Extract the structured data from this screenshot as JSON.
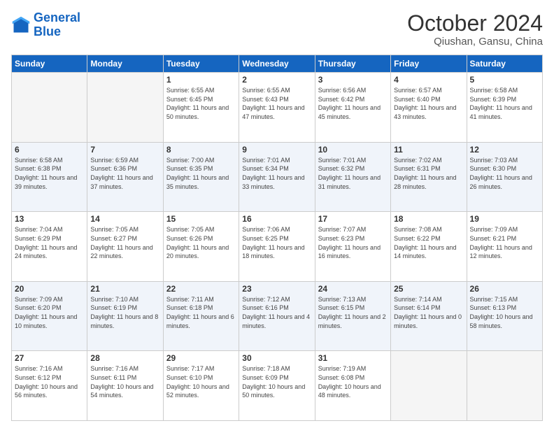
{
  "logo": {
    "line1": "General",
    "line2": "Blue"
  },
  "title": "October 2024",
  "subtitle": "Qiushan, Gansu, China",
  "days_of_week": [
    "Sunday",
    "Monday",
    "Tuesday",
    "Wednesday",
    "Thursday",
    "Friday",
    "Saturday"
  ],
  "weeks": [
    [
      {
        "day": "",
        "sunrise": "",
        "sunset": "",
        "daylight": "",
        "empty": true
      },
      {
        "day": "",
        "sunrise": "",
        "sunset": "",
        "daylight": "",
        "empty": true
      },
      {
        "day": "1",
        "sunrise": "Sunrise: 6:55 AM",
        "sunset": "Sunset: 6:45 PM",
        "daylight": "Daylight: 11 hours and 50 minutes."
      },
      {
        "day": "2",
        "sunrise": "Sunrise: 6:55 AM",
        "sunset": "Sunset: 6:43 PM",
        "daylight": "Daylight: 11 hours and 47 minutes."
      },
      {
        "day": "3",
        "sunrise": "Sunrise: 6:56 AM",
        "sunset": "Sunset: 6:42 PM",
        "daylight": "Daylight: 11 hours and 45 minutes."
      },
      {
        "day": "4",
        "sunrise": "Sunrise: 6:57 AM",
        "sunset": "Sunset: 6:40 PM",
        "daylight": "Daylight: 11 hours and 43 minutes."
      },
      {
        "day": "5",
        "sunrise": "Sunrise: 6:58 AM",
        "sunset": "Sunset: 6:39 PM",
        "daylight": "Daylight: 11 hours and 41 minutes."
      }
    ],
    [
      {
        "day": "6",
        "sunrise": "Sunrise: 6:58 AM",
        "sunset": "Sunset: 6:38 PM",
        "daylight": "Daylight: 11 hours and 39 minutes."
      },
      {
        "day": "7",
        "sunrise": "Sunrise: 6:59 AM",
        "sunset": "Sunset: 6:36 PM",
        "daylight": "Daylight: 11 hours and 37 minutes."
      },
      {
        "day": "8",
        "sunrise": "Sunrise: 7:00 AM",
        "sunset": "Sunset: 6:35 PM",
        "daylight": "Daylight: 11 hours and 35 minutes."
      },
      {
        "day": "9",
        "sunrise": "Sunrise: 7:01 AM",
        "sunset": "Sunset: 6:34 PM",
        "daylight": "Daylight: 11 hours and 33 minutes."
      },
      {
        "day": "10",
        "sunrise": "Sunrise: 7:01 AM",
        "sunset": "Sunset: 6:32 PM",
        "daylight": "Daylight: 11 hours and 31 minutes."
      },
      {
        "day": "11",
        "sunrise": "Sunrise: 7:02 AM",
        "sunset": "Sunset: 6:31 PM",
        "daylight": "Daylight: 11 hours and 28 minutes."
      },
      {
        "day": "12",
        "sunrise": "Sunrise: 7:03 AM",
        "sunset": "Sunset: 6:30 PM",
        "daylight": "Daylight: 11 hours and 26 minutes."
      }
    ],
    [
      {
        "day": "13",
        "sunrise": "Sunrise: 7:04 AM",
        "sunset": "Sunset: 6:29 PM",
        "daylight": "Daylight: 11 hours and 24 minutes."
      },
      {
        "day": "14",
        "sunrise": "Sunrise: 7:05 AM",
        "sunset": "Sunset: 6:27 PM",
        "daylight": "Daylight: 11 hours and 22 minutes."
      },
      {
        "day": "15",
        "sunrise": "Sunrise: 7:05 AM",
        "sunset": "Sunset: 6:26 PM",
        "daylight": "Daylight: 11 hours and 20 minutes."
      },
      {
        "day": "16",
        "sunrise": "Sunrise: 7:06 AM",
        "sunset": "Sunset: 6:25 PM",
        "daylight": "Daylight: 11 hours and 18 minutes."
      },
      {
        "day": "17",
        "sunrise": "Sunrise: 7:07 AM",
        "sunset": "Sunset: 6:23 PM",
        "daylight": "Daylight: 11 hours and 16 minutes."
      },
      {
        "day": "18",
        "sunrise": "Sunrise: 7:08 AM",
        "sunset": "Sunset: 6:22 PM",
        "daylight": "Daylight: 11 hours and 14 minutes."
      },
      {
        "day": "19",
        "sunrise": "Sunrise: 7:09 AM",
        "sunset": "Sunset: 6:21 PM",
        "daylight": "Daylight: 11 hours and 12 minutes."
      }
    ],
    [
      {
        "day": "20",
        "sunrise": "Sunrise: 7:09 AM",
        "sunset": "Sunset: 6:20 PM",
        "daylight": "Daylight: 11 hours and 10 minutes."
      },
      {
        "day": "21",
        "sunrise": "Sunrise: 7:10 AM",
        "sunset": "Sunset: 6:19 PM",
        "daylight": "Daylight: 11 hours and 8 minutes."
      },
      {
        "day": "22",
        "sunrise": "Sunrise: 7:11 AM",
        "sunset": "Sunset: 6:18 PM",
        "daylight": "Daylight: 11 hours and 6 minutes."
      },
      {
        "day": "23",
        "sunrise": "Sunrise: 7:12 AM",
        "sunset": "Sunset: 6:16 PM",
        "daylight": "Daylight: 11 hours and 4 minutes."
      },
      {
        "day": "24",
        "sunrise": "Sunrise: 7:13 AM",
        "sunset": "Sunset: 6:15 PM",
        "daylight": "Daylight: 11 hours and 2 minutes."
      },
      {
        "day": "25",
        "sunrise": "Sunrise: 7:14 AM",
        "sunset": "Sunset: 6:14 PM",
        "daylight": "Daylight: 11 hours and 0 minutes."
      },
      {
        "day": "26",
        "sunrise": "Sunrise: 7:15 AM",
        "sunset": "Sunset: 6:13 PM",
        "daylight": "Daylight: 10 hours and 58 minutes."
      }
    ],
    [
      {
        "day": "27",
        "sunrise": "Sunrise: 7:16 AM",
        "sunset": "Sunset: 6:12 PM",
        "daylight": "Daylight: 10 hours and 56 minutes."
      },
      {
        "day": "28",
        "sunrise": "Sunrise: 7:16 AM",
        "sunset": "Sunset: 6:11 PM",
        "daylight": "Daylight: 10 hours and 54 minutes."
      },
      {
        "day": "29",
        "sunrise": "Sunrise: 7:17 AM",
        "sunset": "Sunset: 6:10 PM",
        "daylight": "Daylight: 10 hours and 52 minutes."
      },
      {
        "day": "30",
        "sunrise": "Sunrise: 7:18 AM",
        "sunset": "Sunset: 6:09 PM",
        "daylight": "Daylight: 10 hours and 50 minutes."
      },
      {
        "day": "31",
        "sunrise": "Sunrise: 7:19 AM",
        "sunset": "Sunset: 6:08 PM",
        "daylight": "Daylight: 10 hours and 48 minutes."
      },
      {
        "day": "",
        "sunrise": "",
        "sunset": "",
        "daylight": "",
        "empty": true
      },
      {
        "day": "",
        "sunrise": "",
        "sunset": "",
        "daylight": "",
        "empty": true
      }
    ]
  ]
}
